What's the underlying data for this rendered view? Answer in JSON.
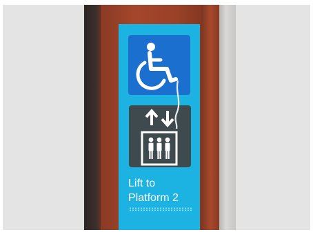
{
  "sign": {
    "line1": "Lift to",
    "line2": "Platform 2"
  },
  "icons": {
    "accessibility": "wheelchair-icon",
    "lift_arrows": "up-down-arrows-icon",
    "lift_car": "lift-people-icon"
  },
  "colors": {
    "sign_blue": "#1cb3e3",
    "wheelchair_panel": "#1b6fce",
    "lift_panel": "#3f4a4f",
    "frame_wood": "#a4462b"
  }
}
